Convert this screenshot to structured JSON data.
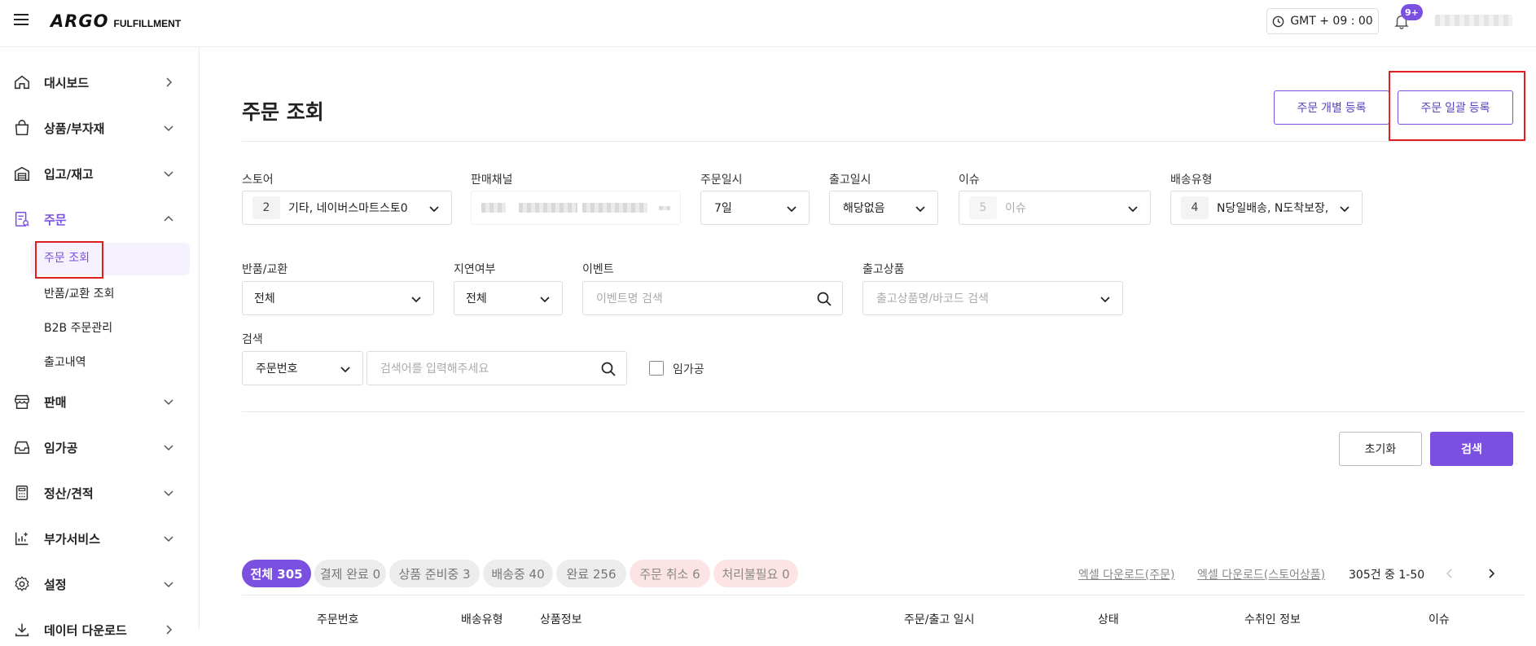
{
  "topbar": {
    "logo_main": "ARGO",
    "logo_sub": "FULFILLMENT",
    "timezone": "GMT + 09 : 00",
    "notification_count": "9+"
  },
  "sidebar": {
    "items": [
      {
        "label": "대시보드",
        "icon": "home-icon"
      },
      {
        "label": "상품/부자재",
        "icon": "shopping-bag-icon"
      },
      {
        "label": "입고/재고",
        "icon": "warehouse-icon"
      },
      {
        "label": "주문",
        "icon": "order-icon"
      },
      {
        "label": "판매",
        "icon": "store-icon"
      },
      {
        "label": "임가공",
        "icon": "tray-icon"
      },
      {
        "label": "정산/견적",
        "icon": "calculator-icon"
      },
      {
        "label": "부가서비스",
        "icon": "chart-plus-icon"
      },
      {
        "label": "설정",
        "icon": "gear-icon"
      },
      {
        "label": "데이터 다운로드",
        "icon": "download-icon"
      }
    ],
    "order_sub": [
      "주문 조회",
      "반품/교환 조회",
      "B2B 주문관리",
      "출고내역"
    ]
  },
  "page": {
    "title": "주문 조회",
    "btn_individual": "주문 개별 등록",
    "btn_bulk": "주문 일괄 등록"
  },
  "filters": {
    "store_label": "스토어",
    "store_count": "2",
    "store_value": "기타, 네이버스마트스토0",
    "channel_label": "판매채널",
    "order_date_label": "주문일시",
    "order_date_value": "7일",
    "ship_date_label": "출고일시",
    "ship_date_value": "해당없음",
    "issue_label": "이슈",
    "issue_count": "5",
    "issue_placeholder": "이슈",
    "delivery_label": "배송유형",
    "delivery_count": "4",
    "delivery_value": "N당일배송, N도착보장,",
    "return_label": "반품/교환",
    "return_value": "전체",
    "delay_label": "지연여부",
    "delay_value": "전체",
    "event_label": "이벤트",
    "event_placeholder": "이벤트명 검색",
    "product_label": "출고상품",
    "product_placeholder": "출고상품명/바코드 검색",
    "search_label": "검색",
    "search_type": "주문번호",
    "search_placeholder": "검색어를 입력해주세요",
    "processing_label": "임가공"
  },
  "actions": {
    "reset": "초기화",
    "search": "검색"
  },
  "status_tabs": [
    {
      "label": "전체 305",
      "style": "all"
    },
    {
      "label": "결제 완료 0",
      "style": "gray"
    },
    {
      "label": "상품 준비중 3",
      "style": "gray"
    },
    {
      "label": "배송중 40",
      "style": "gray"
    },
    {
      "label": "완료 256",
      "style": "gray"
    },
    {
      "label": "주문 취소 6",
      "style": "pink"
    },
    {
      "label": "처리불필요 0",
      "style": "pink"
    }
  ],
  "list_tools": {
    "excel_order": "엑셀 다운로드(주문)",
    "excel_store": "엑셀 다운로드(스토어상품)",
    "page_info": "305건 중 1-50"
  },
  "table_headers": [
    "주문번호",
    "배송유형",
    "상품정보",
    "주문/출고 일시",
    "상태",
    "수취인 정보",
    "이슈"
  ],
  "colors": {
    "accent": "#7b4fe0",
    "highlight_box": "#e01e1e"
  }
}
